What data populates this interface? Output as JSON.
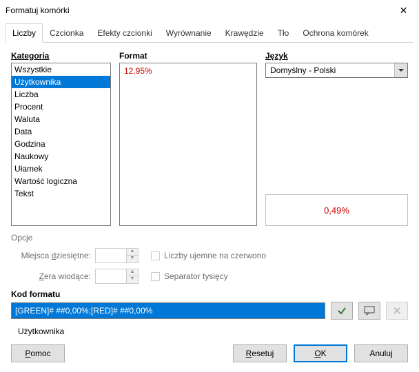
{
  "title": "Formatuj komórki",
  "tabs": [
    "Liczby",
    "Czcionka",
    "Efekty czcionki",
    "Wyrównanie",
    "Krawędzie",
    "Tło",
    "Ochrona komórek"
  ],
  "labels": {
    "category": "Kategoria",
    "format": "Format",
    "language": "Język",
    "options": "Opcje",
    "decimals_pre": "Miejsca ",
    "decimals_key": "d",
    "decimals_post": "ziesiętne:",
    "leading_pre": "",
    "leading_key": "Z",
    "leading_post": "era wiodące:",
    "neg_red": "Liczby ujemne na czerwono",
    "thousands": "Separator tysięcy",
    "format_code": "Kod formatu",
    "user_defined": "Użytkownika"
  },
  "categories": [
    "Wszystkie",
    "Użytkownika",
    "Liczba",
    "Procent",
    "Waluta",
    "Data",
    "Godzina",
    "Naukowy",
    "Ułamek",
    "Wartość logiczna",
    "Tekst"
  ],
  "selected_category_index": 1,
  "format_sample": "12,95%",
  "language_value": "Domyślny - Polski",
  "preview_value": "0,49%",
  "decimals_value": "",
  "leading_value": "",
  "format_code_value": "[GREEN]# ##0,00%;[RED]# ##0,00%",
  "buttons": {
    "help_key": "P",
    "help_post": "omoc",
    "reset_key": "R",
    "reset_post": "esetuj",
    "ok_key": "O",
    "ok_post": "K",
    "cancel": "Anuluj"
  }
}
